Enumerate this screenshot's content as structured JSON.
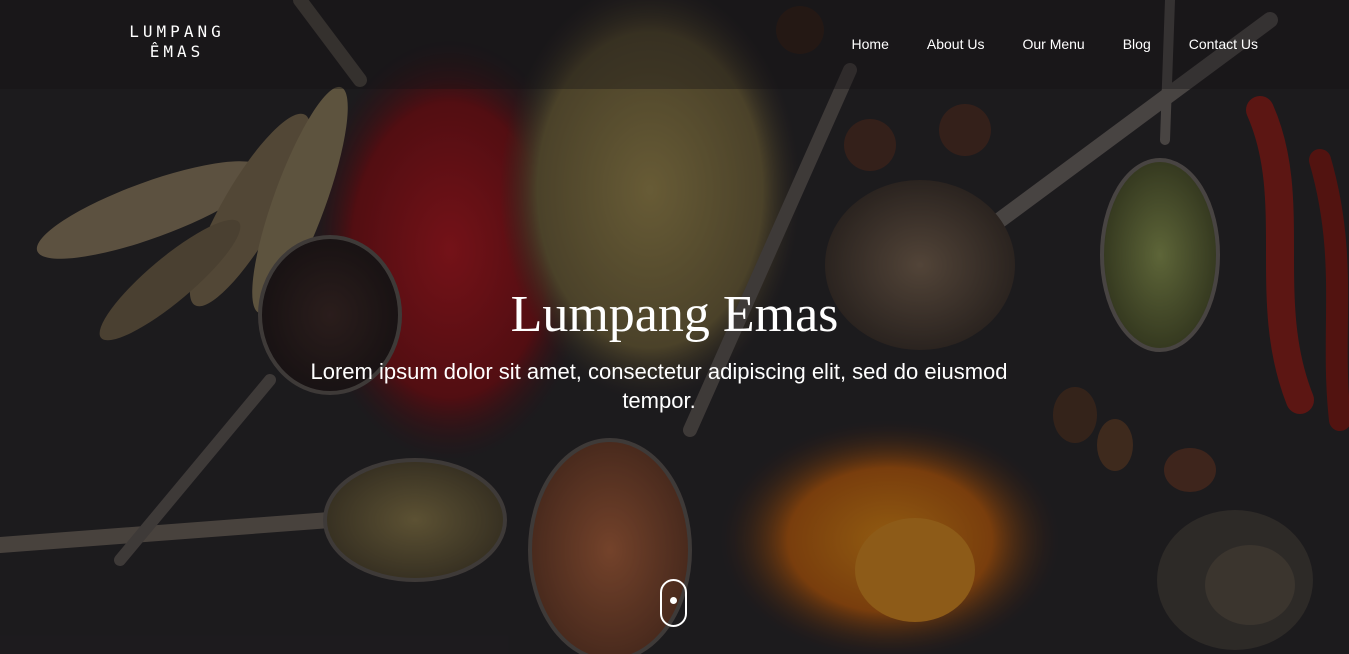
{
  "brand": {
    "line1": "LUMPANG",
    "line2": "ÊMAS"
  },
  "nav": {
    "items": [
      {
        "label": "Home"
      },
      {
        "label": "About Us"
      },
      {
        "label": "Our Menu"
      },
      {
        "label": "Blog"
      },
      {
        "label": "Contact Us"
      }
    ]
  },
  "hero": {
    "title": "Lumpang Emas",
    "subtitle": "Lorem ipsum dolor sit amet, consectetur adipiscing elit, sed do eiusmod tempor."
  },
  "colors": {
    "text": "#ffffff",
    "overlay": "#121012"
  },
  "icons": {
    "scroll": "mouse-scroll-icon"
  }
}
